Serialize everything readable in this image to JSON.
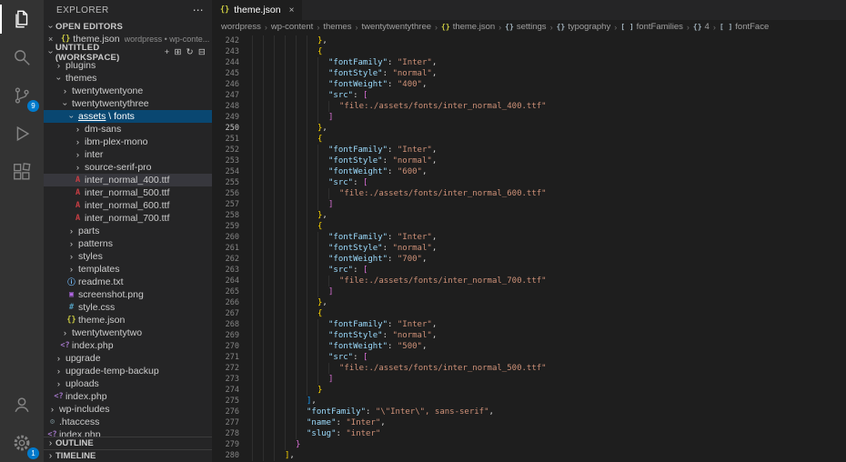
{
  "colors": {
    "accent": "#007acc",
    "selection_primary": "#094771",
    "selection_secondary": "#37373d",
    "json_key": "#9cdcfe",
    "json_string": "#ce9178",
    "bracket_gold": "#ffd700",
    "bracket_pink": "#da70d6",
    "bracket_blue": "#179fff"
  },
  "icon_map": {
    "json": {
      "glyph": "{}",
      "color": "#cbcb41"
    },
    "obj": {
      "glyph": "{}",
      "color": "#9fb0bb"
    },
    "arr": {
      "glyph": "[ ]",
      "color": "#9fb0bb"
    },
    "font": {
      "glyph": "A",
      "color": "#cc3e44"
    },
    "info": {
      "glyph": "ⓘ",
      "color": "#75beff"
    },
    "image": {
      "glyph": "▣",
      "color": "#b267e6"
    },
    "css": {
      "glyph": "#",
      "color": "#519aba"
    },
    "php": {
      "glyph": "<?",
      "color": "#a074c4"
    },
    "config": {
      "glyph": "⚙",
      "color": "#6d8086"
    }
  },
  "activity_bar": {
    "items": [
      {
        "name": "explorer",
        "active": true
      },
      {
        "name": "search"
      },
      {
        "name": "source-control",
        "badge": "9"
      },
      {
        "name": "run-and-debug"
      },
      {
        "name": "extensions"
      }
    ],
    "bottom_items": [
      {
        "name": "account"
      },
      {
        "name": "manage",
        "badge": "1"
      }
    ]
  },
  "sidebar": {
    "title": "EXPLORER",
    "title_actions": "⋯",
    "open_editors": {
      "label": "OPEN EDITORS",
      "items": [
        {
          "close": "×",
          "icon": "json",
          "name": "theme.json",
          "description": "wordpress • wp-conte..."
        }
      ]
    },
    "workspace": {
      "label": "UNTITLED (WORKSPACE)",
      "actions": [
        {
          "name": "new-file",
          "glyph": "+"
        },
        {
          "name": "new-folder",
          "glyph": "⊞"
        },
        {
          "name": "refresh-explorer",
          "glyph": "↻"
        },
        {
          "name": "collapse-folders",
          "glyph": "⊟"
        }
      ]
    },
    "outline": {
      "label": "OUTLINE"
    },
    "timeline": {
      "label": "TIMELINE"
    },
    "tree": [
      {
        "label": "plugins",
        "type": "folder",
        "level": 2,
        "expanded": false
      },
      {
        "label": "themes",
        "type": "folder",
        "level": 2,
        "expanded": true
      },
      {
        "label": "twentytwentyone",
        "type": "folder",
        "level": 3,
        "expanded": false
      },
      {
        "label": "twentytwentythree",
        "type": "folder",
        "level": 3,
        "expanded": true
      },
      {
        "label": "assets \\ fonts",
        "type": "folder",
        "level": 4,
        "expanded": true,
        "sel": "primary",
        "parts": [
          {
            "text": "assets",
            "u": true
          },
          {
            "text": " \\ fonts"
          }
        ]
      },
      {
        "label": "dm-sans",
        "type": "folder",
        "level": 5,
        "expanded": false
      },
      {
        "label": "ibm-plex-mono",
        "type": "folder",
        "level": 5,
        "expanded": false
      },
      {
        "label": "inter",
        "type": "folder",
        "level": 5,
        "expanded": false
      },
      {
        "label": "source-serif-pro",
        "type": "folder",
        "level": 5,
        "expanded": false
      },
      {
        "label": "inter_normal_400.ttf",
        "type": "file",
        "icon": "font",
        "level": 5,
        "sel": "secondary"
      },
      {
        "label": "inter_normal_500.ttf",
        "type": "file",
        "icon": "font",
        "level": 5
      },
      {
        "label": "inter_normal_600.ttf",
        "type": "file",
        "icon": "font",
        "level": 5
      },
      {
        "label": "inter_normal_700.ttf",
        "type": "file",
        "icon": "font",
        "level": 5
      },
      {
        "label": "parts",
        "type": "folder",
        "level": 4,
        "expanded": false
      },
      {
        "label": "patterns",
        "type": "folder",
        "level": 4,
        "expanded": false
      },
      {
        "label": "styles",
        "type": "folder",
        "level": 4,
        "expanded": false
      },
      {
        "label": "templates",
        "type": "folder",
        "level": 4,
        "expanded": false
      },
      {
        "label": "readme.txt",
        "type": "file",
        "icon": "info",
        "level": 4
      },
      {
        "label": "screenshot.png",
        "type": "file",
        "icon": "image",
        "level": 4
      },
      {
        "label": "style.css",
        "type": "file",
        "icon": "css",
        "level": 4
      },
      {
        "label": "theme.json",
        "type": "file",
        "icon": "json",
        "level": 4
      },
      {
        "label": "twentytwentytwo",
        "type": "folder",
        "level": 3,
        "expanded": false
      },
      {
        "label": "index.php",
        "type": "file",
        "icon": "php",
        "level": 3
      },
      {
        "label": "upgrade",
        "type": "folder",
        "level": 2,
        "expanded": false
      },
      {
        "label": "upgrade-temp-backup",
        "type": "folder",
        "level": 2,
        "expanded": false
      },
      {
        "label": "uploads",
        "type": "folder",
        "level": 2,
        "expanded": false
      },
      {
        "label": "index.php",
        "type": "file",
        "icon": "php",
        "level": 2
      },
      {
        "label": "wp-includes",
        "type": "folder",
        "level": 1,
        "expanded": false
      },
      {
        "label": ".htaccess",
        "type": "file",
        "icon": "config",
        "level": 1
      },
      {
        "label": "index.php",
        "type": "file",
        "icon": "php",
        "level": 1
      }
    ]
  },
  "editor": {
    "tab": {
      "icon": "json",
      "label": "theme.json",
      "close": "×"
    },
    "breadcrumb_separator": "›",
    "breadcrumbs": [
      {
        "label": "wordpress"
      },
      {
        "label": "wp-content"
      },
      {
        "label": "themes"
      },
      {
        "label": "twentytwentythree"
      },
      {
        "label": "theme.json",
        "icon": "json"
      },
      {
        "label": "settings",
        "icon": "obj"
      },
      {
        "label": "typography",
        "icon": "obj"
      },
      {
        "label": "fontFamilies",
        "icon": "arr"
      },
      {
        "label": "4",
        "icon": "obj"
      },
      {
        "label": "fontFace",
        "icon": "arr"
      }
    ],
    "active_line": 250,
    "code": {
      "lines": [
        [
          242,
          6,
          [
            [
              "}",
              "g"
            ],
            [
              ",",
              "pun"
            ]
          ]
        ],
        [
          243,
          6,
          [
            [
              "{",
              "g"
            ]
          ]
        ],
        [
          244,
          7,
          [
            [
              "\"fontFamily\"",
              "key"
            ],
            [
              ": ",
              "pun"
            ],
            [
              "\"Inter\"",
              "str"
            ],
            [
              ",",
              "pun"
            ]
          ]
        ],
        [
          245,
          7,
          [
            [
              "\"fontStyle\"",
              "key"
            ],
            [
              ": ",
              "pun"
            ],
            [
              "\"normal\"",
              "str"
            ],
            [
              ",",
              "pun"
            ]
          ]
        ],
        [
          246,
          7,
          [
            [
              "\"fontWeight\"",
              "key"
            ],
            [
              ": ",
              "pun"
            ],
            [
              "\"400\"",
              "str"
            ],
            [
              ",",
              "pun"
            ]
          ]
        ],
        [
          247,
          7,
          [
            [
              "\"src\"",
              "key"
            ],
            [
              ": ",
              "pun"
            ],
            [
              "[",
              "p"
            ]
          ]
        ],
        [
          248,
          8,
          [
            [
              "\"file:./assets/fonts/inter_normal_400.ttf\"",
              "str"
            ]
          ]
        ],
        [
          249,
          7,
          [
            [
              "]",
              "p"
            ]
          ]
        ],
        [
          250,
          6,
          [
            [
              "}",
              "g"
            ],
            [
              ",",
              "pun"
            ]
          ]
        ],
        [
          251,
          6,
          [
            [
              "{",
              "g"
            ]
          ]
        ],
        [
          252,
          7,
          [
            [
              "\"fontFamily\"",
              "key"
            ],
            [
              ": ",
              "pun"
            ],
            [
              "\"Inter\"",
              "str"
            ],
            [
              ",",
              "pun"
            ]
          ]
        ],
        [
          253,
          7,
          [
            [
              "\"fontStyle\"",
              "key"
            ],
            [
              ": ",
              "pun"
            ],
            [
              "\"normal\"",
              "str"
            ],
            [
              ",",
              "pun"
            ]
          ]
        ],
        [
          254,
          7,
          [
            [
              "\"fontWeight\"",
              "key"
            ],
            [
              ": ",
              "pun"
            ],
            [
              "\"600\"",
              "str"
            ],
            [
              ",",
              "pun"
            ]
          ]
        ],
        [
          255,
          7,
          [
            [
              "\"src\"",
              "key"
            ],
            [
              ": ",
              "pun"
            ],
            [
              "[",
              "p"
            ]
          ]
        ],
        [
          256,
          8,
          [
            [
              "\"file:./assets/fonts/inter_normal_600.ttf\"",
              "str"
            ]
          ]
        ],
        [
          257,
          7,
          [
            [
              "]",
              "p"
            ]
          ]
        ],
        [
          258,
          6,
          [
            [
              "}",
              "g"
            ],
            [
              ",",
              "pun"
            ]
          ]
        ],
        [
          259,
          6,
          [
            [
              "{",
              "g"
            ]
          ]
        ],
        [
          260,
          7,
          [
            [
              "\"fontFamily\"",
              "key"
            ],
            [
              ": ",
              "pun"
            ],
            [
              "\"Inter\"",
              "str"
            ],
            [
              ",",
              "pun"
            ]
          ]
        ],
        [
          261,
          7,
          [
            [
              "\"fontStyle\"",
              "key"
            ],
            [
              ": ",
              "pun"
            ],
            [
              "\"normal\"",
              "str"
            ],
            [
              ",",
              "pun"
            ]
          ]
        ],
        [
          262,
          7,
          [
            [
              "\"fontWeight\"",
              "key"
            ],
            [
              ": ",
              "pun"
            ],
            [
              "\"700\"",
              "str"
            ],
            [
              ",",
              "pun"
            ]
          ]
        ],
        [
          263,
          7,
          [
            [
              "\"src\"",
              "key"
            ],
            [
              ": ",
              "pun"
            ],
            [
              "[",
              "p"
            ]
          ]
        ],
        [
          264,
          8,
          [
            [
              "\"file:./assets/fonts/inter_normal_700.ttf\"",
              "str"
            ]
          ]
        ],
        [
          265,
          7,
          [
            [
              "]",
              "p"
            ]
          ]
        ],
        [
          266,
          6,
          [
            [
              "}",
              "g"
            ],
            [
              ",",
              "pun"
            ]
          ]
        ],
        [
          267,
          6,
          [
            [
              "{",
              "g"
            ]
          ]
        ],
        [
          268,
          7,
          [
            [
              "\"fontFamily\"",
              "key"
            ],
            [
              ": ",
              "pun"
            ],
            [
              "\"Inter\"",
              "str"
            ],
            [
              ",",
              "pun"
            ]
          ]
        ],
        [
          269,
          7,
          [
            [
              "\"fontStyle\"",
              "key"
            ],
            [
              ": ",
              "pun"
            ],
            [
              "\"normal\"",
              "str"
            ],
            [
              ",",
              "pun"
            ]
          ]
        ],
        [
          270,
          7,
          [
            [
              "\"fontWeight\"",
              "key"
            ],
            [
              ": ",
              "pun"
            ],
            [
              "\"500\"",
              "str"
            ],
            [
              ",",
              "pun"
            ]
          ]
        ],
        [
          271,
          7,
          [
            [
              "\"src\"",
              "key"
            ],
            [
              ": ",
              "pun"
            ],
            [
              "[",
              "p"
            ]
          ]
        ],
        [
          272,
          8,
          [
            [
              "\"file:./assets/fonts/inter_normal_500.ttf\"",
              "str"
            ]
          ]
        ],
        [
          273,
          7,
          [
            [
              "]",
              "p"
            ]
          ]
        ],
        [
          274,
          6,
          [
            [
              "}",
              "g"
            ]
          ]
        ],
        [
          275,
          5,
          [
            [
              "]",
              "b"
            ],
            [
              ",",
              "pun"
            ]
          ]
        ],
        [
          276,
          5,
          [
            [
              "\"fontFamily\"",
              "key"
            ],
            [
              ": ",
              "pun"
            ],
            [
              "\"\\\"Inter\\\", sans-serif\"",
              "str"
            ],
            [
              ",",
              "pun"
            ]
          ]
        ],
        [
          277,
          5,
          [
            [
              "\"name\"",
              "key"
            ],
            [
              ": ",
              "pun"
            ],
            [
              "\"Inter\"",
              "str"
            ],
            [
              ",",
              "pun"
            ]
          ]
        ],
        [
          278,
          5,
          [
            [
              "\"slug\"",
              "key"
            ],
            [
              ": ",
              "pun"
            ],
            [
              "\"inter\"",
              "str"
            ]
          ]
        ],
        [
          279,
          4,
          [
            [
              "}",
              "p"
            ]
          ]
        ],
        [
          280,
          3,
          [
            [
              "]",
              "g"
            ],
            [
              ",",
              "pun"
            ]
          ]
        ]
      ]
    }
  }
}
